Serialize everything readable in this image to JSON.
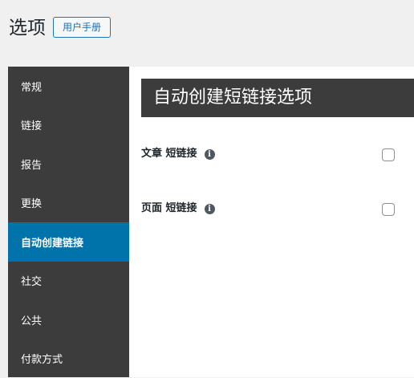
{
  "header": {
    "title": "选项",
    "manual_button": "用户手册"
  },
  "sidebar": {
    "items": [
      {
        "label": "常规",
        "active": false
      },
      {
        "label": "链接",
        "active": false
      },
      {
        "label": "报告",
        "active": false
      },
      {
        "label": "更换",
        "active": false
      },
      {
        "label": "自动创建链接",
        "active": true
      },
      {
        "label": "社交",
        "active": false
      },
      {
        "label": "公共",
        "active": false
      },
      {
        "label": "付款方式",
        "active": false
      }
    ]
  },
  "main": {
    "section_title": "自动创建短链接选项",
    "options": [
      {
        "label": "文章 短链接",
        "info_icon": "info-icon",
        "checked": false
      },
      {
        "label": "页面 短链接",
        "info_icon": "info-icon",
        "checked": false
      }
    ]
  },
  "colors": {
    "accent": "#0073aa",
    "sidebar_bg": "#3c3c3c",
    "page_bg": "#f0f0f1"
  }
}
